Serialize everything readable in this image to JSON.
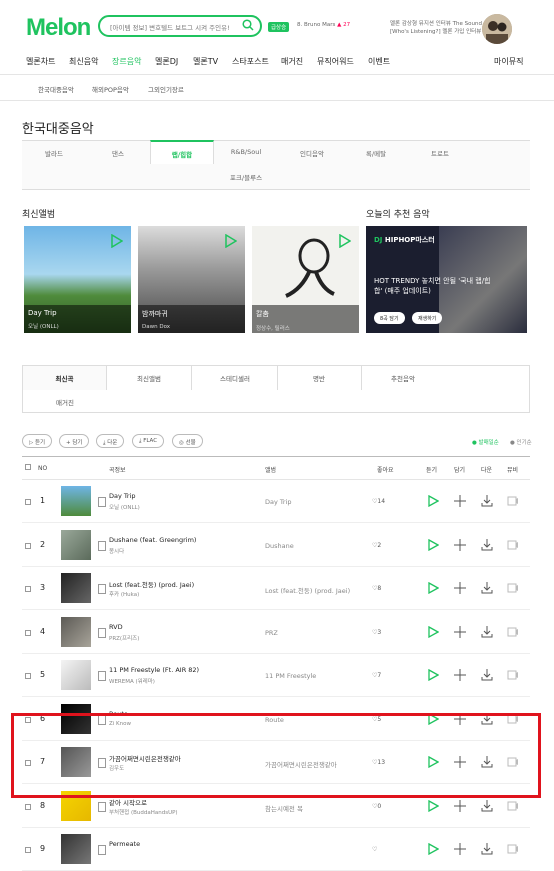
{
  "header": {
    "logo": "Melon",
    "search_placeholder": "[아이템 정보] 변호텔드 보트그 시켜 주인유!",
    "hot_badge": "급상승",
    "trend_rank": "8",
    "trend_artist": "Bruno Mars",
    "trend_change": "▲ 27",
    "ad_text": "멜론 감상형 뮤지션 인터뷰 The Sound [Who's Listening?] 멜론 가입 인터뷰",
    "avatar_icon": "user-photo"
  },
  "nav": {
    "items": [
      "멜론차트",
      "최신음악",
      "장르음악",
      "멜론DJ",
      "멜론TV",
      "스타포스트",
      "매거진",
      "뮤직어워드",
      "이벤트"
    ],
    "active": "장르음악",
    "mymusic": "마이뮤직"
  },
  "subnav": {
    "items": [
      "한국대중음악",
      "해외POP음악",
      "그외인기장르"
    ]
  },
  "page_title": "한국대중음악",
  "genres": {
    "row1": [
      "발라드",
      "댄스",
      "랩/힙합",
      "R&B/Soul",
      "인디음악",
      "록/메탈",
      "트로트"
    ],
    "row2": [
      "포크/블루스"
    ],
    "active": "랩/힙합"
  },
  "latest_album": {
    "title": "최신앨범",
    "albums": [
      {
        "title": "Day Trip",
        "artist": "오닐 (ONLL)"
      },
      {
        "title": "밤까마귀",
        "artist": "Dawn Dox"
      },
      {
        "title": "칼춤",
        "artist": "정상수, 릴러스"
      }
    ]
  },
  "recommend": {
    "title": "오늘의 추천 음악",
    "label_dj": "DJ",
    "label_name": "HIPHOP마스터",
    "text": "HOT TRENDY 놓치면 안될 '국내 랩/힙합' (매주 업데이트)",
    "btn1": "8곡 담기",
    "btn2": "재생하기"
  },
  "tabs": {
    "row1": [
      "최신곡",
      "최신앨범",
      "스테디셀러",
      "명반",
      "추천음악"
    ],
    "row2": [
      "매거진"
    ],
    "active": "최신곡"
  },
  "actions": {
    "pills": [
      "듣기",
      "담기",
      "다운",
      "FLAC",
      "선물"
    ],
    "sort_active": "● 발매일순",
    "sort_other": "● 인기순"
  },
  "table": {
    "headers": [
      "NO",
      "곡정보",
      "앨범",
      "좋아요",
      "듣기",
      "담기",
      "다운",
      "뮤비"
    ],
    "rows": [
      {
        "no": "1",
        "title": "Day Trip",
        "artist": "오닐 (ONLL)",
        "album": "Day Trip",
        "likes": "14"
      },
      {
        "no": "2",
        "title": "Dushane (feat. Greengrim)",
        "artist": "몽시다",
        "album": "Dushane",
        "likes": "2"
      },
      {
        "no": "3",
        "title": "Lost (feat.천둥) (prod. Jaei)",
        "artist": "후카 (Huka)",
        "album": "Lost (feat.천둥) (prod. Jaei)",
        "likes": "8"
      },
      {
        "no": "4",
        "title": "RVD",
        "artist": "PRZ(프리즈)",
        "album": "PRZ",
        "likes": "3"
      },
      {
        "no": "5",
        "title": "11 PM Freestyle (Ft. AIR 82)",
        "artist": "WEREMA (워레마)",
        "album": "11 PM Freestyle",
        "likes": "7"
      },
      {
        "no": "6",
        "title": "Route",
        "artist": "Zi Know",
        "album": "Route",
        "likes": "5"
      },
      {
        "no": "7",
        "title": "가끔어쩌면시린은전쟁같아",
        "artist": "김우도",
        "album": "가끔어쩌면시린은전쟁같아",
        "likes": "13"
      },
      {
        "no": "8",
        "title": "같아 시작으로",
        "artist": "부처핸접 (BuddaHandsUP)",
        "album": "참는시예전 복",
        "likes": "0"
      },
      {
        "no": "9",
        "title": "Permeate",
        "artist": "",
        "album": "",
        "likes": ""
      }
    ]
  },
  "colors": {
    "brand": "#1fc35f",
    "highlight": "#e0131d"
  }
}
